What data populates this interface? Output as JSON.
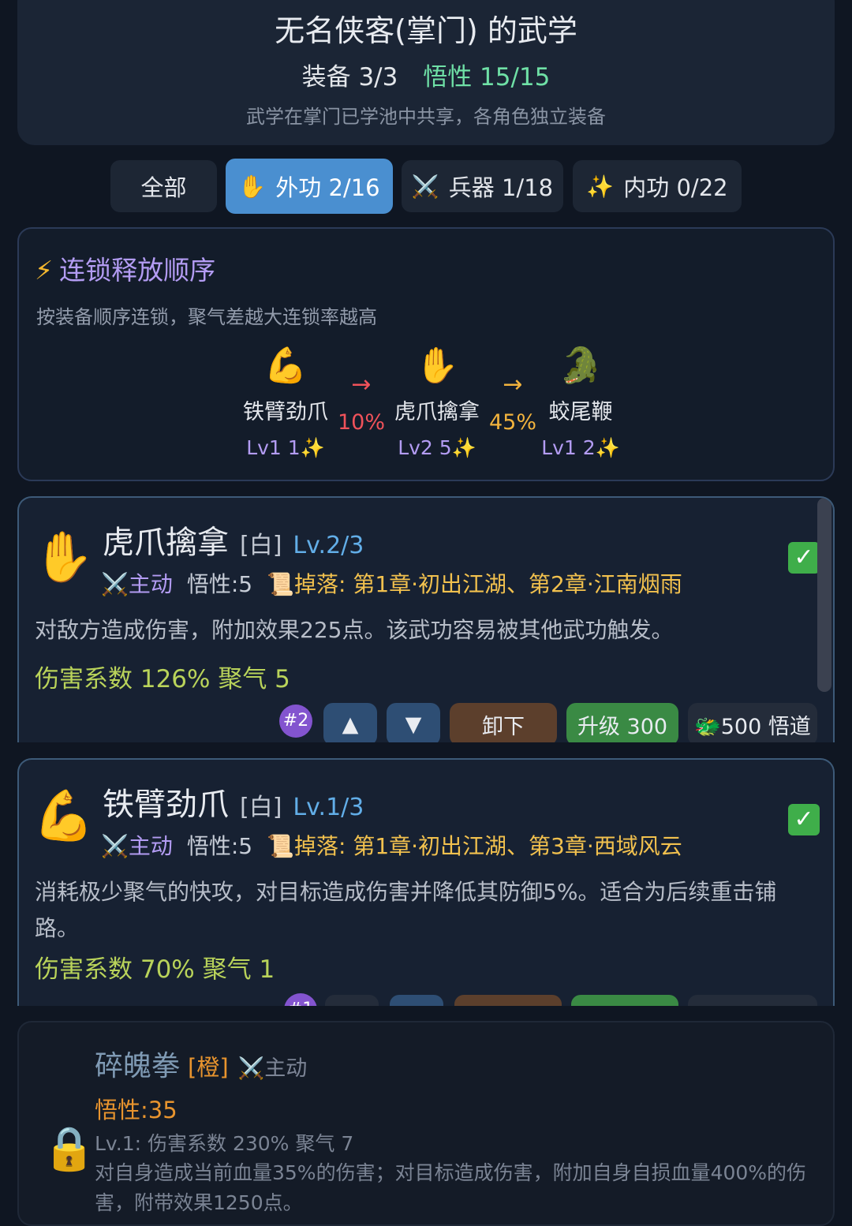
{
  "header": {
    "title": "无名侠客(掌门) 的武学",
    "equip": "装备 3/3",
    "wuxing": "悟性 15/15",
    "subtitle": "武学在掌门已学池中共享，各角色独立装备"
  },
  "tabs": [
    {
      "icon": "",
      "label": "全部"
    },
    {
      "icon": "✋",
      "label": "外功 2/16"
    },
    {
      "icon": "⚔️",
      "label": "兵器 1/18"
    },
    {
      "icon": "✨",
      "label": "内功 0/22"
    }
  ],
  "chain": {
    "icon": "⚡",
    "title": "连锁释放顺序",
    "desc": "按装备顺序连锁，聚气差越大连锁率越高",
    "nodes": [
      {
        "icon": "💪",
        "name": "铁臂劲爪",
        "level": "Lv1 1✨"
      },
      {
        "icon": "✋",
        "name": "虎爪擒拿",
        "level": "Lv2 5✨"
      },
      {
        "icon": "🐊",
        "name": "蛟尾鞭",
        "level": "Lv1 2✨"
      }
    ],
    "links": [
      {
        "arrow": "→",
        "pct": "10%",
        "color": "#f0525a"
      },
      {
        "arrow": "→",
        "pct": "45%",
        "color": "#f2b33d"
      }
    ]
  },
  "cards": [
    {
      "icon": "✋",
      "name": "虎爪擒拿",
      "rarity": "[白]",
      "level": "Lv.2/3",
      "active": "⚔️主动",
      "wuxing": "悟性:5",
      "drop": "📜掉落: 第1章·初出江湖、第2章·江南烟雨",
      "desc": "对敌方造成伤害，附加效果225点。该武功容易被其他武功触发。",
      "stat": "伤害系数 126%  聚气 5",
      "checked": "✓",
      "index": "#2",
      "btn_up": "▲",
      "btn_down": "▼",
      "btn_unload": "卸下",
      "btn_upgrade": "升级 300",
      "btn_tao": "🐲500 悟道"
    },
    {
      "icon": "💪",
      "name": "铁臂劲爪",
      "rarity": "[白]",
      "level": "Lv.1/3",
      "active": "⚔️主动",
      "wuxing": "悟性:5",
      "drop": "📜掉落: 第1章·初出江湖、第3章·西域风云",
      "desc": "消耗极少聚气的快攻，对目标造成伤害并降低其防御5%。适合为后续重击铺路。",
      "stat": "伤害系数 70%  聚气 1",
      "checked": "✓",
      "index": "#1"
    }
  ],
  "locked": {
    "icon": "🔒",
    "name": "碎魄拳",
    "rarity": "[橙]",
    "active": "⚔️主动",
    "requirement": "悟性:35",
    "level_info": "Lv.1: 伤害系数 230%  聚气 7",
    "desc": "对自身造成当前血量35%的伤害；对目标造成伤害，附加自身自损血量400%的伤害，附带效果1250点。"
  }
}
